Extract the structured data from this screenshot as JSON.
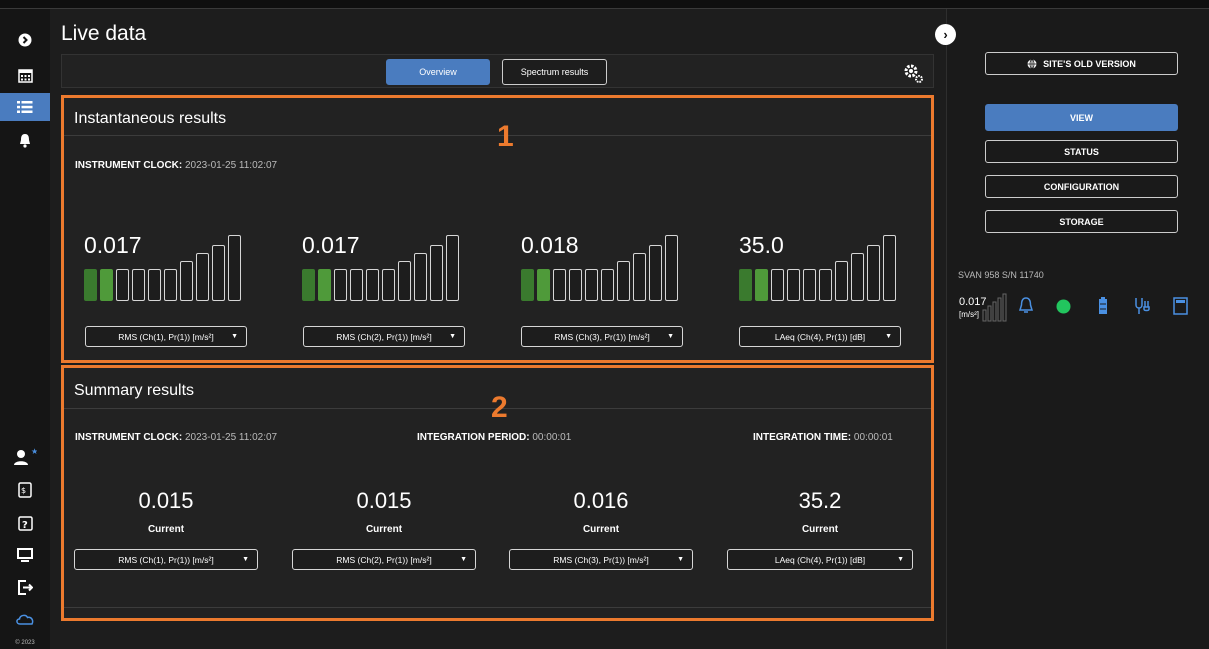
{
  "sidebar": {
    "items": [
      {
        "icon": "chevron-right-circle-icon"
      },
      {
        "icon": "calendar-icon"
      },
      {
        "icon": "list-icon",
        "active": true
      },
      {
        "icon": "bell-icon"
      }
    ],
    "bottom_items": [
      {
        "icon": "user-star-icon"
      },
      {
        "icon": "invoice-icon"
      },
      {
        "icon": "help-icon"
      },
      {
        "icon": "monitor-icon"
      },
      {
        "icon": "logout-icon"
      },
      {
        "icon": "cloud-icon"
      }
    ],
    "copyright": "© 2023"
  },
  "page": {
    "title": "Live data"
  },
  "tabs": {
    "overview": "Overview",
    "spectrum": "Spectrum results"
  },
  "instantaneous": {
    "title": "Instantaneous results",
    "badge": "1",
    "clock_label": "INSTRUMENT CLOCK:",
    "clock_value": "2023-01-25 11:02:07",
    "meters": [
      {
        "value": "0.017",
        "level_bars_lit": 2,
        "select": "RMS (Ch(1), Pr(1)) [m/s²]"
      },
      {
        "value": "0.017",
        "level_bars_lit": 2,
        "select": "RMS (Ch(2), Pr(1)) [m/s²]"
      },
      {
        "value": "0.018",
        "level_bars_lit": 2,
        "select": "RMS (Ch(3), Pr(1)) [m/s²]"
      },
      {
        "value": "35.0",
        "level_bars_lit": 2,
        "select": "LAeq (Ch(4), Pr(1)) [dB]"
      }
    ]
  },
  "summary": {
    "title": "Summary results",
    "badge": "2",
    "clock_label": "INSTRUMENT CLOCK:",
    "clock_value": "2023-01-25 11:02:07",
    "period_label": "INTEGRATION PERIOD:",
    "period_value": "00:00:01",
    "time_label": "INTEGRATION TIME:",
    "time_value": "00:00:01",
    "results": [
      {
        "value": "0.015",
        "caption": "Current",
        "select": "RMS (Ch(1), Pr(1)) [m/s²]"
      },
      {
        "value": "0.015",
        "caption": "Current",
        "select": "RMS (Ch(2), Pr(1)) [m/s²]"
      },
      {
        "value": "0.016",
        "caption": "Current",
        "select": "RMS (Ch(3), Pr(1)) [m/s²]"
      },
      {
        "value": "35.2",
        "caption": "Current",
        "select": "LAeq (Ch(4), Pr(1)) [dB]"
      }
    ]
  },
  "right_panel": {
    "old_version": "SITE'S OLD VERSION",
    "menu": [
      "VIEW",
      "STATUS",
      "CONFIGURATION",
      "STORAGE"
    ],
    "device": "SVAN 958 S/N 11740",
    "device_value": "0.017",
    "device_unit": "[m/s²]"
  },
  "colors": {
    "accent": "#4a7cbf",
    "highlight": "#ec7a2e",
    "green": "#22c55e",
    "level_on": "#3a7a2e"
  }
}
